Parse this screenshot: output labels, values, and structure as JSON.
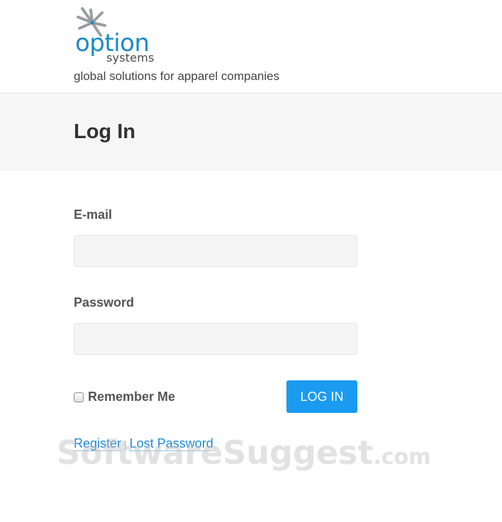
{
  "brand": {
    "logo_word": "option",
    "logo_sub": "systems",
    "tagline": "global solutions for apparel companies",
    "accent_color": "#1b8ac6",
    "mark_icon": "starburst-icon"
  },
  "page": {
    "title": "Log In"
  },
  "form": {
    "email_label": "E-mail",
    "email_value": "",
    "password_label": "Password",
    "password_value": "",
    "remember_label": "Remember Me",
    "remember_checked": false,
    "submit_label": "LOG IN",
    "button_color": "#1a9bf0"
  },
  "links": {
    "register": "Register",
    "separator": "|",
    "lost_password": "Lost Password"
  },
  "watermark": {
    "main": "SoftwareSuggest",
    "suffix": ".com"
  }
}
